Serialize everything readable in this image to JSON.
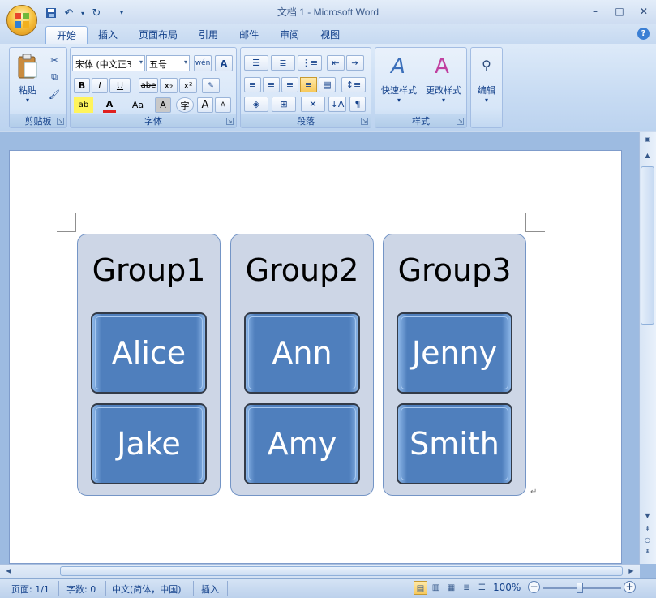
{
  "window": {
    "title": "文档 1 - Microsoft Word"
  },
  "quick_access": {
    "items": [
      "save-icon",
      "undo-icon",
      "redo-icon",
      "customize-icon"
    ]
  },
  "tabs": [
    "开始",
    "插入",
    "页面布局",
    "引用",
    "邮件",
    "审阅",
    "视图"
  ],
  "ribbon": {
    "clipboard": {
      "label": "剪贴板",
      "paste": "粘贴"
    },
    "font": {
      "label": "字体",
      "font_name": "宋体 (中文正3",
      "font_size": "五号",
      "bold": "B",
      "italic": "I",
      "underline": "U",
      "strike": "abe",
      "sub": "x₂",
      "sup": "x²",
      "change_case": "Aa",
      "grow": "A",
      "shrink": "A",
      "clear": "A",
      "enclose": "字",
      "phonetic": "wén"
    },
    "paragraph": {
      "label": "段落"
    },
    "styles": {
      "label": "样式",
      "quick": "快速样式",
      "change": "更改样式"
    },
    "editing": {
      "label": "编辑"
    }
  },
  "smartart": {
    "groups": [
      {
        "title": "Group1",
        "members": [
          "Alice",
          "Jake"
        ]
      },
      {
        "title": "Group2",
        "members": [
          "Ann",
          "Amy"
        ]
      },
      {
        "title": "Group3",
        "members": [
          "Jenny",
          "Smith"
        ]
      }
    ]
  },
  "status": {
    "page": "页面: 1/1",
    "words": "字数: 0",
    "language": "中文(简体，中国)",
    "mode": "插入",
    "zoom": "100%",
    "zoom_value": 100
  },
  "colors": {
    "accent": "#4f7fbd",
    "group_bg": "#cdd6e6",
    "ribbon": "#c7dbf3"
  }
}
